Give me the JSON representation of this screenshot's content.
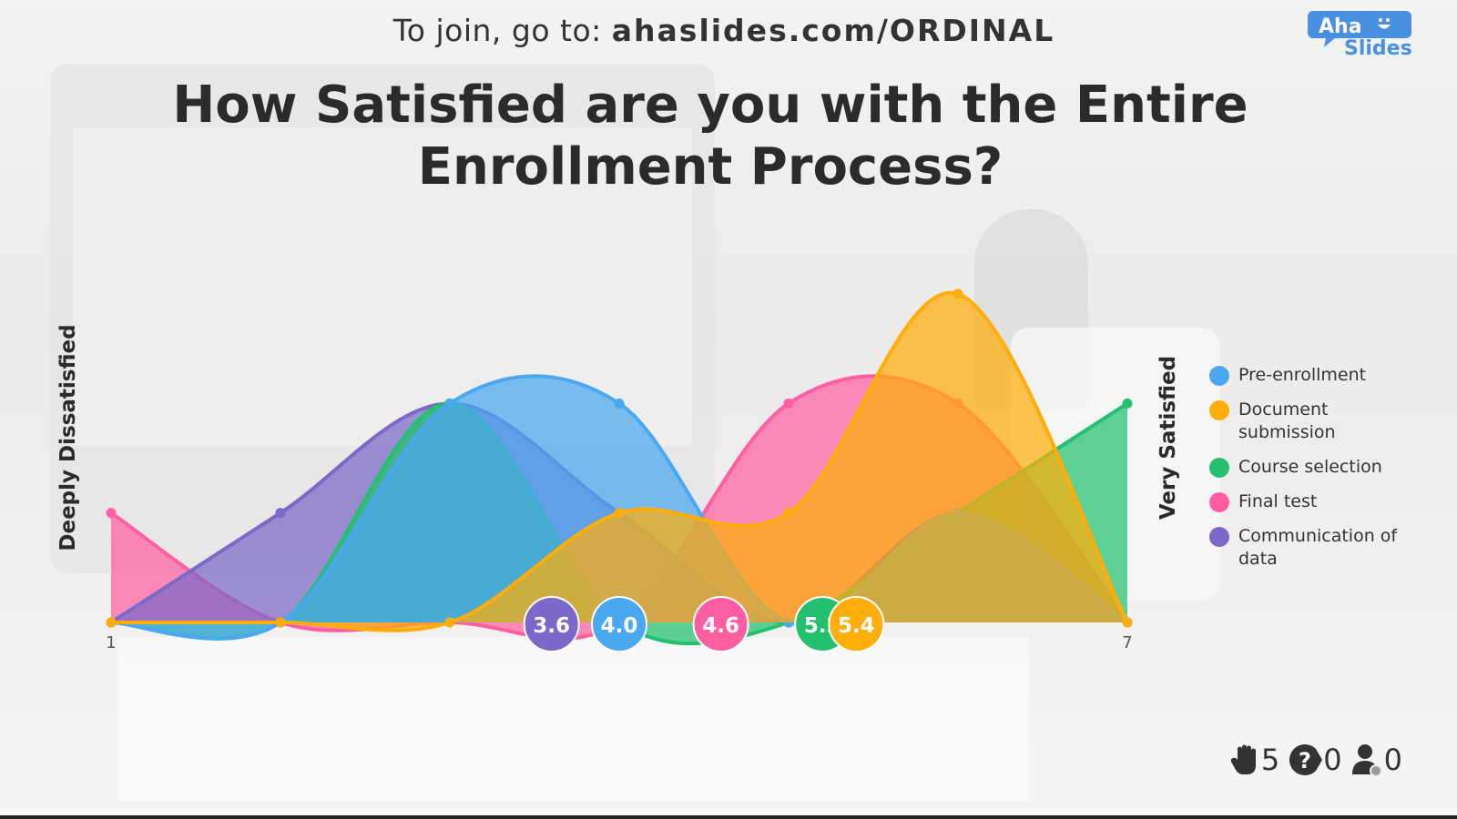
{
  "header": {
    "join_prefix": "To join, go to: ",
    "join_url": "ahaslides.com/ORDINAL"
  },
  "logo": {
    "text_top": "Aha",
    "text_bottom": "Slides"
  },
  "chart_data": {
    "type": "area",
    "title": "How Satisfied are you with the Entire Enrollment Process?",
    "x": [
      1,
      2,
      3,
      4,
      5,
      6,
      7
    ],
    "x_tick_labels": [
      "1",
      "7"
    ],
    "left_label": "Deeply Dissatisfied",
    "right_label": "Very Satisfied",
    "ylim": [
      0,
      3
    ],
    "legend_position": "right",
    "series": [
      {
        "name": "Final test",
        "color": "#ff5fa2",
        "values": [
          1,
          0,
          0,
          0,
          2,
          2,
          0
        ],
        "mean": "4.6"
      },
      {
        "name": "Communication of data",
        "color": "#7b68c8",
        "values": [
          0,
          1,
          2,
          1,
          0,
          1,
          0
        ],
        "mean": "3.6"
      },
      {
        "name": "Course selection",
        "color": "#23c06f",
        "values": [
          0,
          0,
          2,
          0,
          0,
          1,
          2
        ],
        "mean": "5.2"
      },
      {
        "name": "Pre-enrollment",
        "color": "#4aa8f0",
        "values": [
          0,
          0,
          2,
          2,
          0,
          1,
          0
        ],
        "mean": "4.0"
      },
      {
        "name": "Document submission",
        "color": "#ffad0a",
        "values": [
          0,
          0,
          0,
          1,
          1,
          3,
          0
        ],
        "mean": "5.4"
      }
    ]
  },
  "legend": [
    {
      "label": "Pre-enrollment",
      "color": "#4aa8f0"
    },
    {
      "label": "Document submission",
      "color": "#ffad0a"
    },
    {
      "label": "Course selection",
      "color": "#23c06f"
    },
    {
      "label": "Final test",
      "color": "#ff5fa2"
    },
    {
      "label": "Communication of data",
      "color": "#7b68c8"
    }
  ],
  "stats": {
    "hands": "5",
    "questions": "0",
    "audience": "0"
  }
}
